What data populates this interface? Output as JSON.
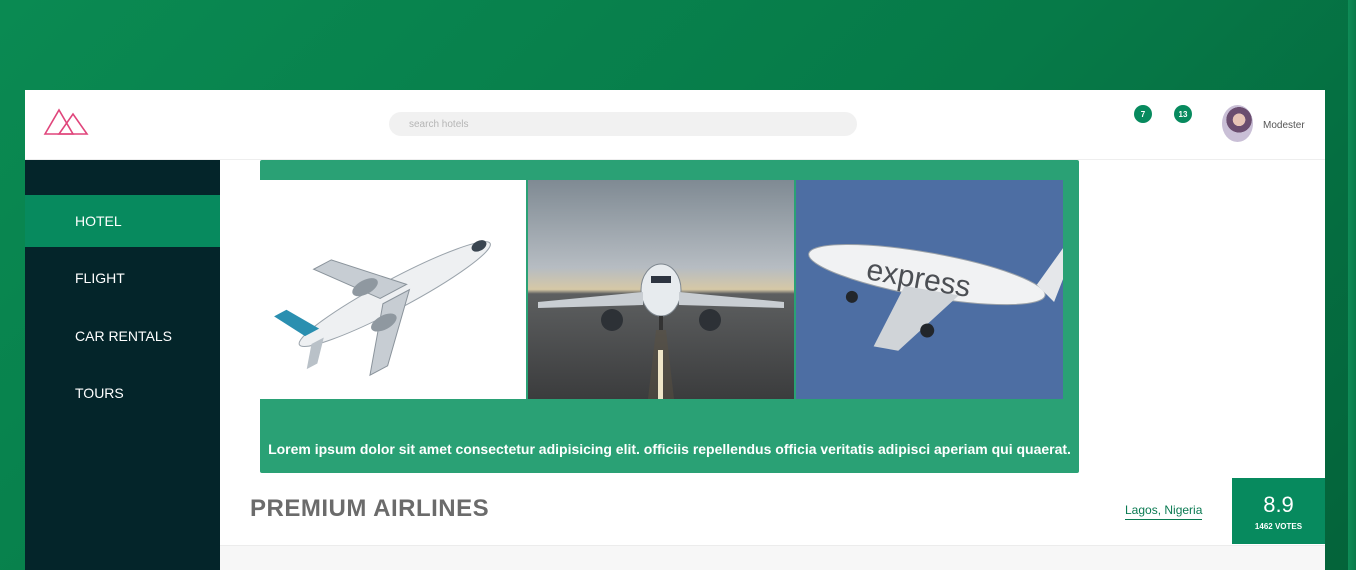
{
  "header": {
    "search_placeholder": "search hotels",
    "badges": [
      "7",
      "13"
    ],
    "username": "Modester"
  },
  "sidebar": {
    "items": [
      {
        "label": "HOTEL",
        "active": true
      },
      {
        "label": "FLIGHT",
        "active": false
      },
      {
        "label": "CAR RENTALS",
        "active": false
      },
      {
        "label": "TOURS",
        "active": false
      }
    ]
  },
  "hero": {
    "description": "Lorem ipsum dolor sit amet consectetur adipisicing elit. officiis repellendus officia veritatis adipisci aperiam qui quaerat.",
    "photo3_caption": "express"
  },
  "listing": {
    "title": "PREMIUM AIRLINES",
    "location": "Lagos, Nigeria",
    "score": "8.9",
    "votes": "1462 VOTES"
  },
  "colors": {
    "accent": "#078a5e",
    "sidebar_bg": "#04252a",
    "hero_bg": "#2aa175"
  }
}
